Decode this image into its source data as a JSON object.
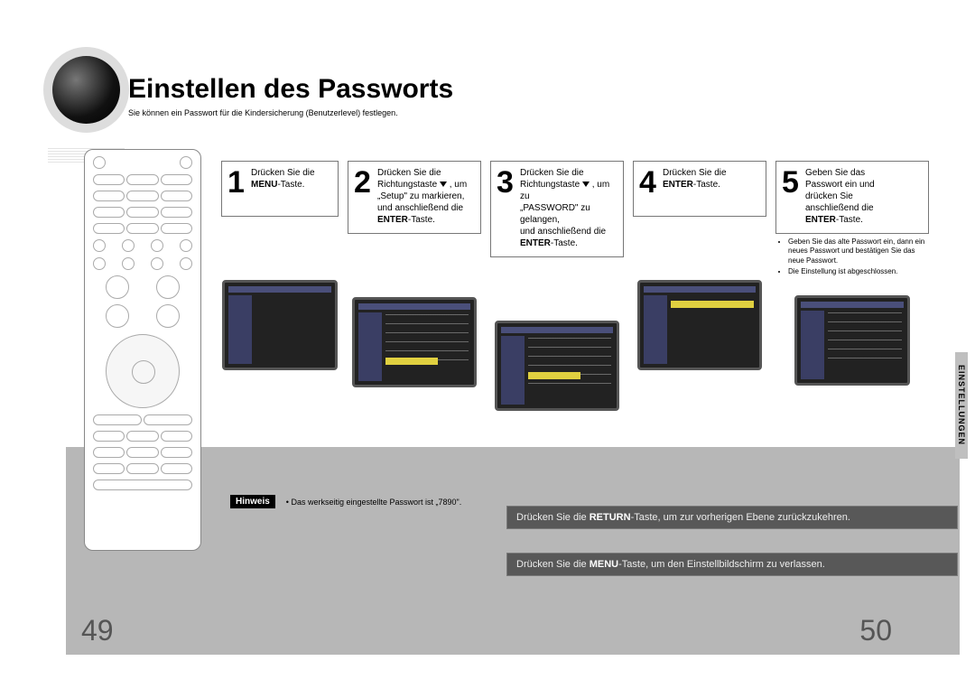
{
  "title": "Einstellen des Passworts",
  "subtitle": "Sie können ein Passwort für die Kindersicherung (Benutzerlevel) festlegen.",
  "steps": [
    {
      "num": "1",
      "text_pre": "Drücken Sie die ",
      "text_bold": "MENU",
      "text_post": "-Taste."
    },
    {
      "num": "2",
      "line1": "Drücken Sie die",
      "line2_pre": "Richtungstaste ",
      "line2_post": " , um",
      "line3": "„Setup\" zu markieren,",
      "line4": "und anschließend die",
      "line5_bold": "ENTER",
      "line5_post": "-Taste."
    },
    {
      "num": "3",
      "line1": "Drücken Sie die",
      "line2_pre": "Richtungstaste ",
      "line2_post": " , um zu",
      "line3": "„PASSWORD\" zu gelangen,",
      "line4": "und anschließend die",
      "line5_bold": "ENTER",
      "line5_post": "-Taste."
    },
    {
      "num": "4",
      "text_pre": "Drücken Sie die ",
      "text_bold": "ENTER",
      "text_post": "-Taste."
    },
    {
      "num": "5",
      "line1": "Geben Sie das",
      "line2": "Passwort ein und",
      "line3": "drücken Sie",
      "line4": "anschließend die",
      "line5_bold": "ENTER",
      "line5_post": "-Taste.",
      "notes": [
        "Geben Sie das alte Passwort ein, dann ein neues Passwort und bestätigen Sie das neue Passwort.",
        "Die Einstellung ist abgeschlossen."
      ]
    }
  ],
  "side_tab": "EINSTELLUNGEN",
  "hinweis": {
    "tag": "Hinweis",
    "text": "Das werkseitig eingestellte Passwort ist „7890\"."
  },
  "bottom_notes": {
    "return_pre": "Drücken Sie die ",
    "return_bold": "RETURN",
    "return_post": "-Taste, um zur vorherigen Ebene zurückzukehren.",
    "menu_pre": "Drücken Sie die ",
    "menu_bold": "MENU",
    "menu_post": "-Taste, um den Einstellbildschirm zu verlassen."
  },
  "page_left": "49",
  "page_right": "50"
}
